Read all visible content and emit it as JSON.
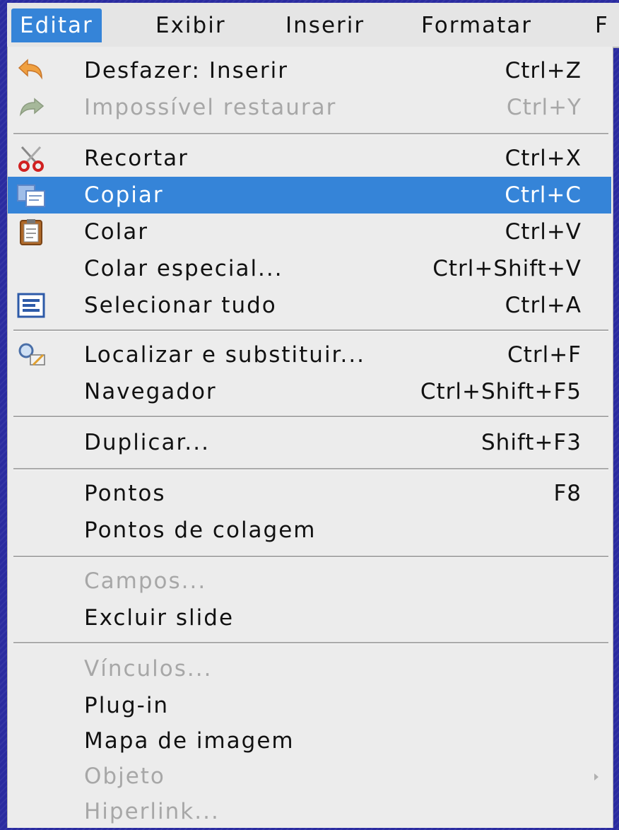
{
  "menubar": {
    "items": [
      "Editar",
      "Exibir",
      "Inserir",
      "Formatar",
      "F"
    ]
  },
  "menu": {
    "items": [
      {
        "label": "Desfazer: Inserir",
        "accel": "Ctrl+Z",
        "icon": "undo-icon"
      },
      {
        "label": "Impossível restaurar",
        "accel": "Ctrl+Y",
        "icon": "redo-icon",
        "disabled": true
      },
      {
        "label": "Recortar",
        "accel": "Ctrl+X",
        "icon": "scissors-icon"
      },
      {
        "label": "Copiar",
        "accel": "Ctrl+C",
        "icon": "copy-icon",
        "highlighted": true
      },
      {
        "label": "Colar",
        "accel": "Ctrl+V",
        "icon": "clipboard-icon"
      },
      {
        "label": "Colar especial...",
        "accel": "Ctrl+Shift+V"
      },
      {
        "label": "Selecionar tudo",
        "accel": "Ctrl+A",
        "icon": "select-all-icon"
      },
      {
        "label": "Localizar e substituir...",
        "accel": "Ctrl+F",
        "icon": "find-replace-icon"
      },
      {
        "label": "Navegador",
        "accel": "Ctrl+Shift+F5"
      },
      {
        "label": "Duplicar...",
        "accel": "Shift+F3"
      },
      {
        "label": "Pontos",
        "accel": "F8"
      },
      {
        "label": "Pontos de colagem",
        "accel": ""
      },
      {
        "label": "Campos...",
        "accel": "",
        "disabled": true
      },
      {
        "label": "Excluir slide",
        "accel": ""
      },
      {
        "label": "Vínculos...",
        "accel": "",
        "disabled": true
      },
      {
        "label": "Plug-in",
        "accel": ""
      },
      {
        "label": "Mapa de imagem",
        "accel": ""
      },
      {
        "label": "Objeto",
        "accel": "",
        "disabled": true,
        "submenu": true
      },
      {
        "label": "Hiperlink...",
        "accel": "",
        "disabled": true
      }
    ]
  },
  "colors": {
    "highlight": "#3584d8",
    "menu_bg": "#ececec",
    "desktop": "#2a2ba0",
    "disabled_text": "#a7a7a7"
  }
}
